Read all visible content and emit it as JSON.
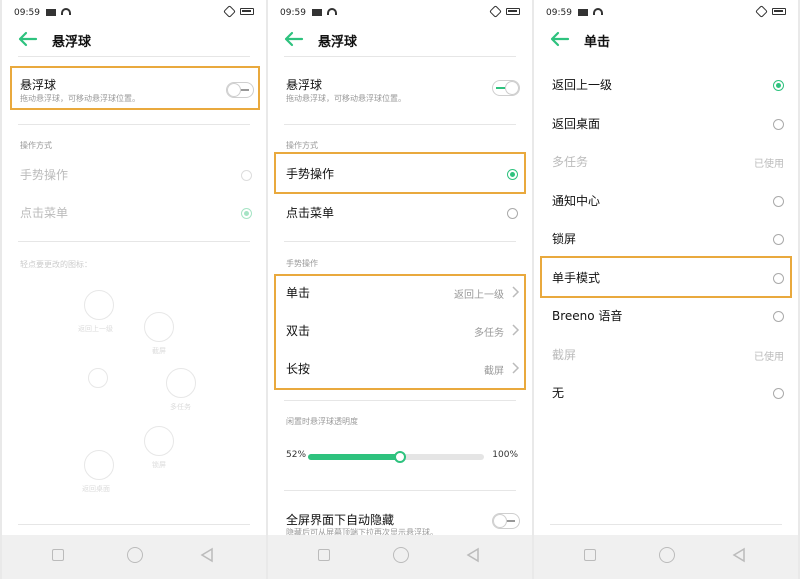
{
  "status": {
    "time": "09:59"
  },
  "screen1": {
    "title": "悬浮球",
    "toggle_row": {
      "label": "悬浮球",
      "desc": "拖动悬浮球，可移动悬浮球位置。",
      "on": false
    },
    "section_mode": "操作方式",
    "mode_options": [
      {
        "label": "手势操作",
        "selected": false
      },
      {
        "label": "点击菜单",
        "selected": true
      }
    ],
    "menu_hint": "轻点要更改的图标：",
    "wheel_labels": [
      "返回上一级",
      "截屏",
      "多任务",
      "锁屏",
      "返回桌面"
    ]
  },
  "screen2": {
    "title": "悬浮球",
    "toggle_row": {
      "label": "悬浮球",
      "desc": "拖动悬浮球，可移动悬浮球位置。",
      "on": true
    },
    "section_mode": "操作方式",
    "mode_options": [
      {
        "label": "手势操作",
        "selected": true
      },
      {
        "label": "点击菜单",
        "selected": false
      }
    ],
    "section_gesture": "手势操作",
    "gestures": [
      {
        "label": "单击",
        "value": "返回上一级"
      },
      {
        "label": "双击",
        "value": "多任务"
      },
      {
        "label": "长按",
        "value": "截屏"
      }
    ],
    "opacity_title": "闲置时悬浮球透明度",
    "opacity": {
      "min_label": "52%",
      "max_label": "100%",
      "value": 0.52
    },
    "autohide": {
      "label": "全屏界面下自动隐藏",
      "desc": "隐藏后可从屏幕顶端下拉再次显示悬浮球。"
    }
  },
  "screen3": {
    "title": "单击",
    "options": [
      {
        "label": "返回上一级",
        "selected": true,
        "disabled": false,
        "value": ""
      },
      {
        "label": "返回桌面",
        "selected": false,
        "disabled": false,
        "value": ""
      },
      {
        "label": "多任务",
        "selected": false,
        "disabled": true,
        "value": "已使用"
      },
      {
        "label": "通知中心",
        "selected": false,
        "disabled": false,
        "value": ""
      },
      {
        "label": "锁屏",
        "selected": false,
        "disabled": false,
        "value": ""
      },
      {
        "label": "单手模式",
        "selected": false,
        "disabled": false,
        "value": ""
      },
      {
        "label": "Breeno 语音",
        "selected": false,
        "disabled": false,
        "value": ""
      },
      {
        "label": "截屏",
        "selected": false,
        "disabled": true,
        "value": "已使用"
      },
      {
        "label": "无",
        "selected": false,
        "disabled": false,
        "value": ""
      }
    ]
  },
  "icons": {
    "back": "arrow-left-icon",
    "radio": "radio-icon",
    "chevron": "chevron-right-icon",
    "nav_recent": "square-icon",
    "nav_home": "circle-icon",
    "nav_back": "triangle-back-icon"
  },
  "colors": {
    "accent": "#2ec27e",
    "highlight": "#e9a93d",
    "secondary_text": "#999999"
  }
}
